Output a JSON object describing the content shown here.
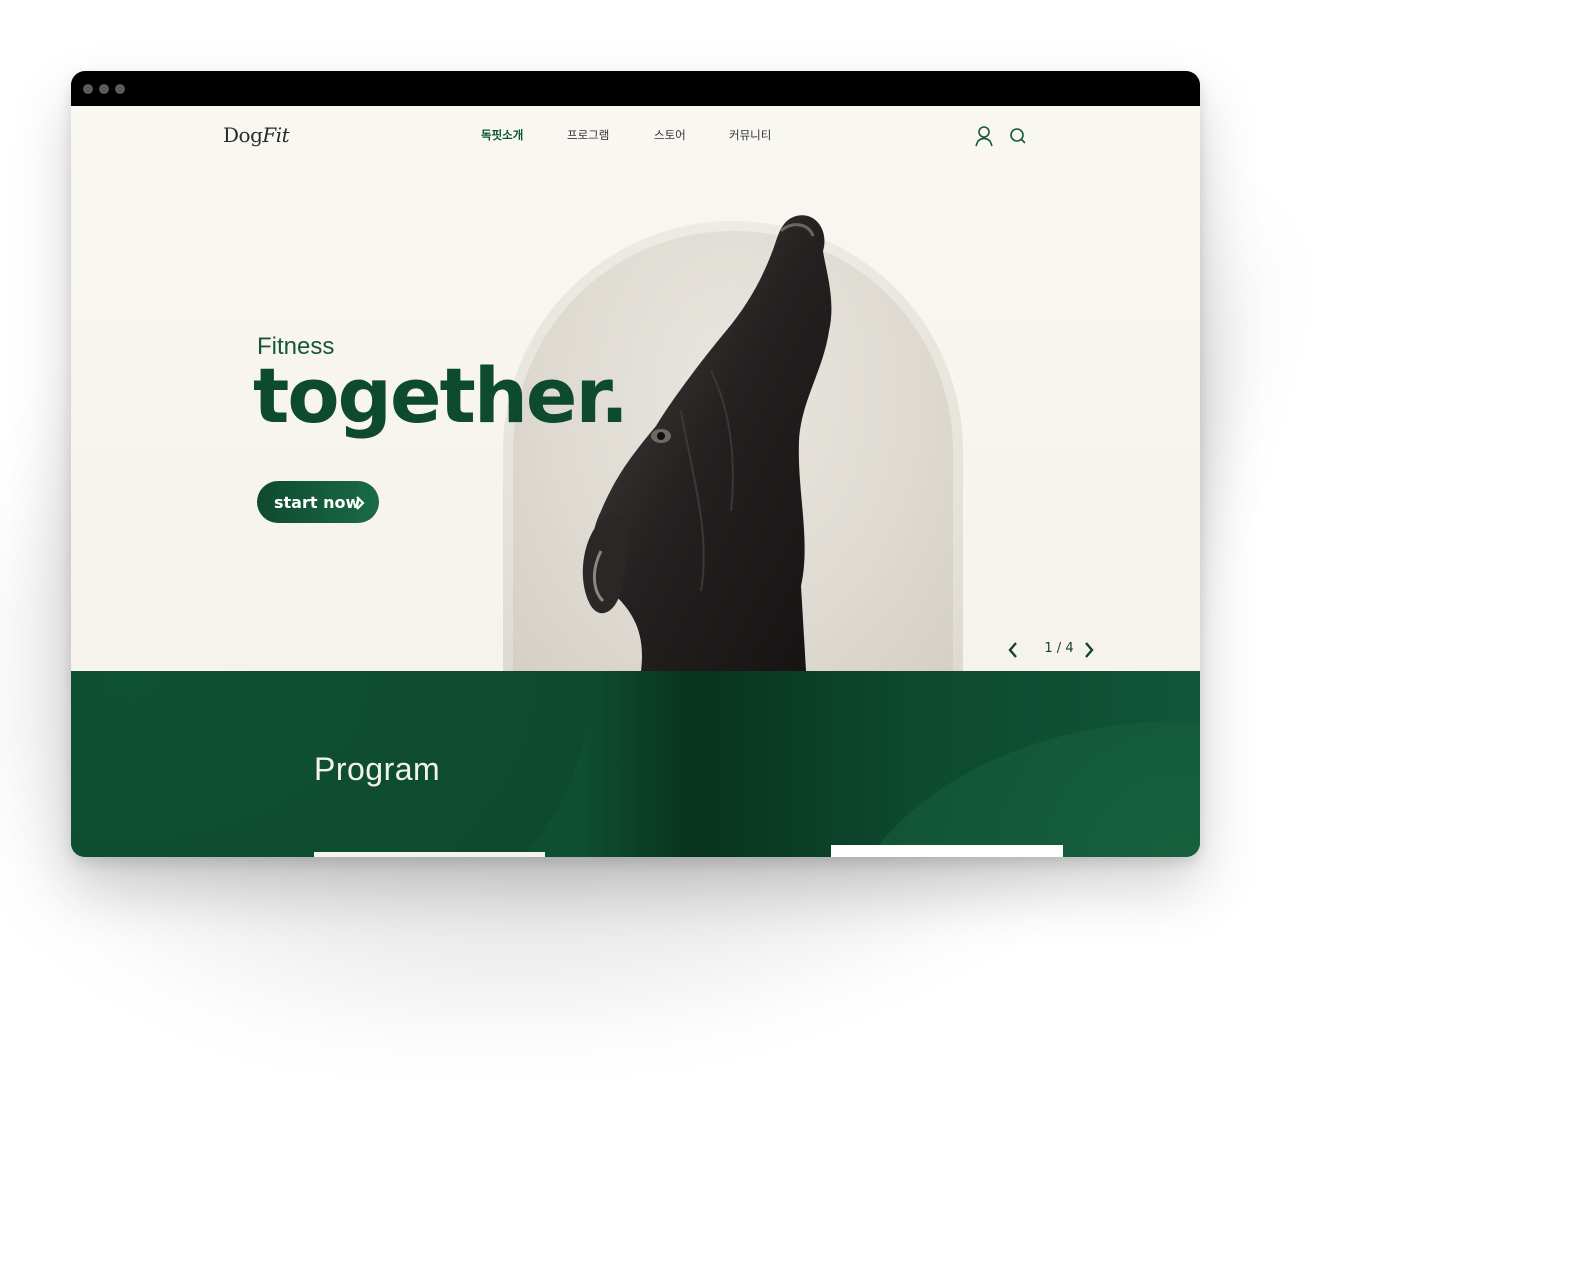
{
  "browser": {
    "dots": 3
  },
  "nav": {
    "logo_prefix": "Dog",
    "logo_suffix": "Fit",
    "menu": [
      {
        "label": "독핏소개",
        "active": true
      },
      {
        "label": "프로그램",
        "active": false
      },
      {
        "label": "스토어",
        "active": false
      },
      {
        "label": "커뮤니티",
        "active": false
      }
    ],
    "icons": [
      "user-icon",
      "search-icon"
    ]
  },
  "hero": {
    "subtitle": "Fitness",
    "title": "together.",
    "cta_label": "start now",
    "slider": {
      "current": 1,
      "total": 4,
      "counter_text": "1 / 4"
    }
  },
  "program": {
    "title": "Program"
  },
  "colors": {
    "brand_green": "#0d4a2f",
    "hero_bg": "#f8f6f0",
    "program_bg": "#0c4a2f"
  }
}
